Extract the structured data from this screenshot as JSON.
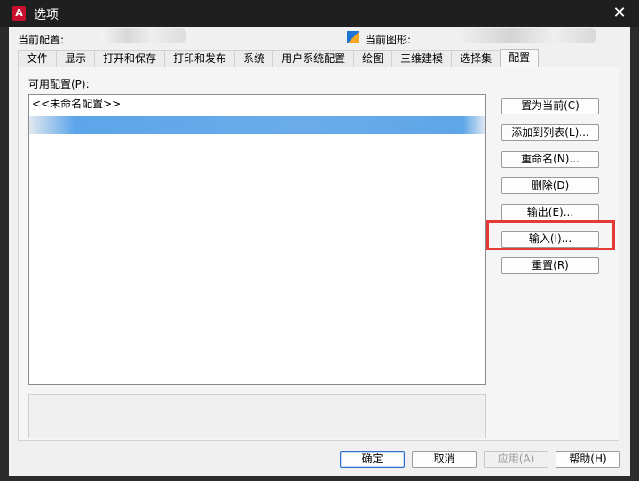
{
  "window": {
    "title": "选项",
    "app_icon_text": "A"
  },
  "header": {
    "current_profile_label": "当前配置:",
    "current_drawing_label": "当前图形:"
  },
  "tabs": [
    {
      "label": "文件",
      "active": false
    },
    {
      "label": "显示",
      "active": false
    },
    {
      "label": "打开和保存",
      "active": false
    },
    {
      "label": "打印和发布",
      "active": false
    },
    {
      "label": "系统",
      "active": false
    },
    {
      "label": "用户系统配置",
      "active": false
    },
    {
      "label": "绘图",
      "active": false
    },
    {
      "label": "三维建模",
      "active": false
    },
    {
      "label": "选择集",
      "active": false
    },
    {
      "label": "配置",
      "active": true
    }
  ],
  "profiles": {
    "label": "可用配置(P):",
    "items": [
      "<<未命名配置>>"
    ]
  },
  "side_buttons": {
    "set_current": "置为当前(C)",
    "add_to_list": "添加到列表(L)...",
    "rename": "重命名(N)...",
    "delete": "删除(D)",
    "export": "输出(E)...",
    "import": "输入(I)...",
    "reset": "重置(R)"
  },
  "footer": {
    "ok": "确定",
    "cancel": "取消",
    "apply": "应用(A)",
    "help": "帮助(H)"
  },
  "colors": {
    "highlight": "#e53935",
    "titlebar": "#1f1f1f"
  }
}
